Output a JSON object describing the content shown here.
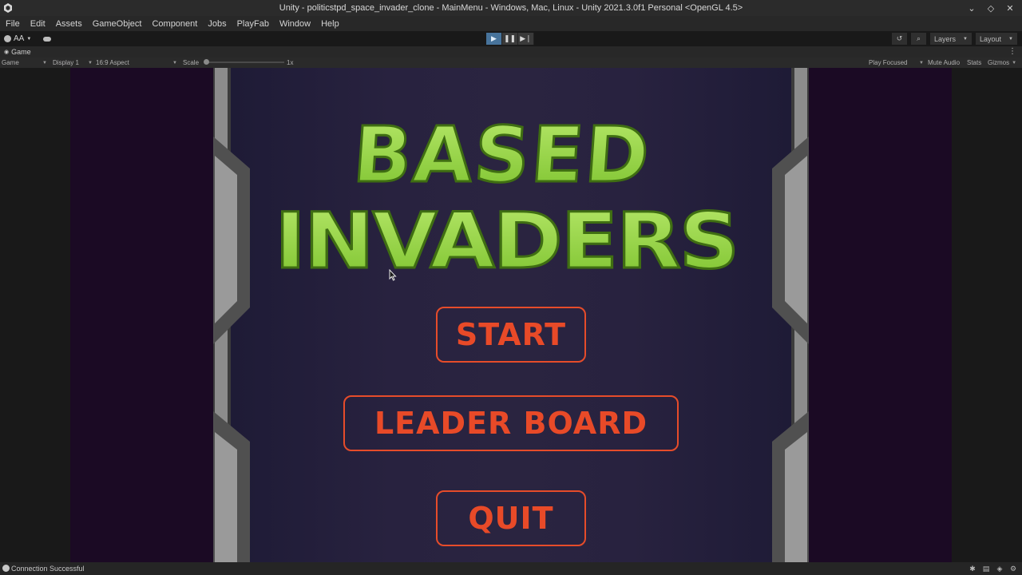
{
  "window": {
    "title": "Unity - politicstpd_space_invader_clone - MainMenu - Windows, Mac, Linux - Unity 2021.3.0f1 Personal <OpenGL 4.5>",
    "controls": [
      "⌄",
      "◇",
      "✕"
    ]
  },
  "menubar": {
    "items": [
      "File",
      "Edit",
      "Assets",
      "GameObject",
      "Component",
      "Jobs",
      "PlayFab",
      "Window",
      "Help"
    ]
  },
  "toolbar": {
    "account_label": "AA",
    "layers_label": "Layers",
    "layout_label": "Layout"
  },
  "game_tab": {
    "label": "Game"
  },
  "game_toolbar": {
    "mode": "Game",
    "display": "Display 1",
    "aspect": "16:9 Aspect",
    "scale_label": "Scale",
    "scale_value": "1x",
    "play_focused": "Play Focused",
    "mute_audio": "Mute Audio",
    "stats": "Stats",
    "gizmos": "Gizmos"
  },
  "game": {
    "logo_line1": "BASED",
    "logo_line2": "INVADERS",
    "start_label": "START",
    "leaderboard_label": "LEADER BOARD",
    "quit_label": "QUIT",
    "colors": {
      "logo_green": "#8fd13a",
      "button_orange": "#e64c2a",
      "background": "#28223f"
    }
  },
  "statusbar": {
    "message": "Connection Successful"
  }
}
